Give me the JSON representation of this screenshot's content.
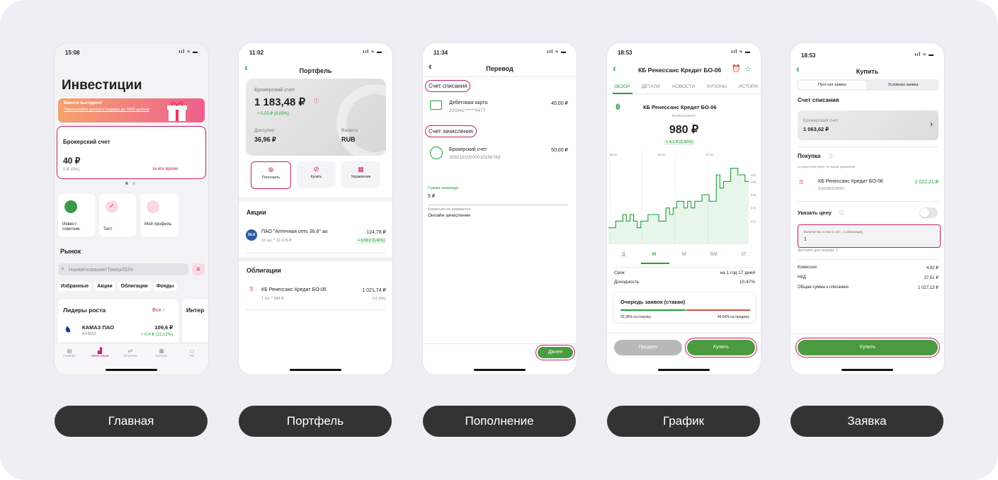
{
  "captions": [
    "Главная",
    "Портфель",
    "Пополнение",
    "График",
    "Заявка"
  ],
  "status": {
    "s1": "15:08",
    "s2": "11:02",
    "s3": "11:34",
    "s4": "18:53",
    "s5": "18:53",
    "icons": "ııl ≈ ▬"
  },
  "home": {
    "title": "Инвестиции",
    "banner_title": "Вместе выгоднее!",
    "banner_text": "Пересылайте доступ к подарку до 3000 рублей",
    "broker_label": "Брокерский счет",
    "broker_value": "40 ₽",
    "broker_change": "0 ₽ (0%)",
    "broker_period": "за все время",
    "tiles": [
      "Инвест-советник",
      "Тест",
      "Мой профиль"
    ],
    "market_title": "Рынок",
    "search_placeholder": "Наименование/Тикер/ISIN",
    "chips": [
      "Избранные",
      "Акции",
      "Облигации",
      "Фонды"
    ],
    "leaders_title": "Лидеры роста",
    "leaders_all": "Все",
    "second_card": "Интер",
    "stock_name": "КАМАЗ ПАО",
    "stock_ticker": "КАМАЗ",
    "stock_price": "109,6 ₽",
    "stock_change": "+ 0,4 ₽ (22,12%)",
    "tabs": [
      "Главная",
      "Инвестиции",
      "Платежи",
      "Каталог",
      "Чат"
    ]
  },
  "portfolio": {
    "header": "Портфель",
    "account_label": "Брокерский счет",
    "account_value": "1 183,48 ₽",
    "account_change": "+ 0,50 ₽ (0,05%)",
    "available_label": "Доступно",
    "available_value": "36,96 ₽",
    "currency_label": "Валюта",
    "currency_value": "RUB",
    "actions": [
      "Пополнить",
      "Купить",
      "Управление"
    ],
    "stocks_title": "Акции",
    "stock_name": "ПАО \"Аптечная сеть 36,6\" ао",
    "stock_qty": "10 шт. * 12,478 ₽",
    "stock_value": "124,78 ₽",
    "stock_change": "+ 6,58 ₽ (5,46%)",
    "stock_logo": "36.6",
    "bonds_title": "Облигации",
    "bond_name": "КБ Ренессанс Кредит БО-06",
    "bond_qty": "1 шт. * 984 ₽",
    "bond_value": "1 021,74 ₽",
    "bond_change": "0 ₽ (0%)"
  },
  "transfer": {
    "header": "Перевод",
    "from_title": "Счет списания",
    "from_name": "Дебетовая карта",
    "from_number": "220341******0477",
    "from_value": "40,00 ₽",
    "to_title": "Счет зачисления",
    "to_name": "Брокерский счет",
    "to_number": "30601810000010188783",
    "to_value": "50,00 ₽",
    "sum_label": "Сумма перевода",
    "sum_value": "5 ₽",
    "fee_label": "Комиссия не взимается",
    "fee_value": "Онлайн зачисление",
    "next_button": "Далее"
  },
  "chart_screen": {
    "header": "КБ Ренессанс Кредит БО-06",
    "tabs": [
      "ОБЗОР",
      "ДЕТАЛИ",
      "НОВОСТИ",
      "КУПОНЫ",
      "ИСТОРИ"
    ],
    "name": "КБ Ренессанс Кредит БО-06",
    "isin": "RU000A102RN7",
    "price": "980 ₽",
    "change": "+ 4,1 ₽ (0,42%)",
    "periods": [
      "Д",
      "Н",
      "М",
      "6М",
      "1Г"
    ],
    "term_label": "Срок",
    "term_value": "на 1 год 17 дней",
    "yield_label": "Доходность",
    "yield_value": "10,47%",
    "orderbook_title": "Очередь заявок (стакан)",
    "buy_share": "50,36% на покупку",
    "sell_share": "49,64% на продажу",
    "sell_button": "Продать",
    "buy_button": "Купить"
  },
  "chart_data": {
    "type": "line",
    "x": [
      1,
      2,
      3,
      4,
      5,
      6,
      7,
      8,
      9,
      10,
      11,
      12,
      13,
      14,
      15,
      16,
      17,
      18,
      19,
      20,
      21,
      22,
      23,
      24,
      25,
      26,
      27,
      28,
      29,
      30,
      31,
      32,
      33,
      34,
      35,
      36,
      37,
      38,
      39,
      40
    ],
    "values": [
      973,
      973,
      974,
      974,
      975,
      974,
      975,
      974,
      973,
      974,
      974,
      975,
      975,
      975,
      974,
      974,
      976,
      975,
      976,
      977,
      977,
      976,
      977,
      976,
      977,
      977,
      978,
      978,
      977,
      977,
      981,
      979,
      980,
      980,
      982,
      982,
      981,
      981,
      980,
      980
    ],
    "x_ticks": [
      "25.01",
      "26.01",
      "27.01"
    ],
    "y_ticks": [
      "981",
      "980",
      "978",
      "976",
      "974"
    ],
    "ylim": [
      972,
      984
    ]
  },
  "order": {
    "header": "Купить",
    "tab_simple": "Простая заявка",
    "tab_conditional": "Условная заявка",
    "from_title": "Счет списания",
    "account_label": "Брокерский счет",
    "account_value": "1 063,62 ₽",
    "purchase_title": "Покупка",
    "purchase_note": "по рыночной цене, не выше указанной",
    "bond_name": "КБ Ренессанс Кредит БО-06",
    "bond_isin": "RU000A102RN7",
    "bond_price": "1 022,21 ₽",
    "price_toggle": "Указать цену",
    "lots_label": "Количество лотов (1 лот = 1 облигация)",
    "lots_value": "1",
    "available": "Доступно для покупки: 1",
    "commission_label": "Комиссия",
    "commission_value": "4,92 ₽",
    "nkd_label": "НКД",
    "nkd_value": "37,51 ₽",
    "total_label": "Общая сумма к списанию",
    "total_value": "1 027,13 ₽",
    "buy_button": "Купить"
  }
}
